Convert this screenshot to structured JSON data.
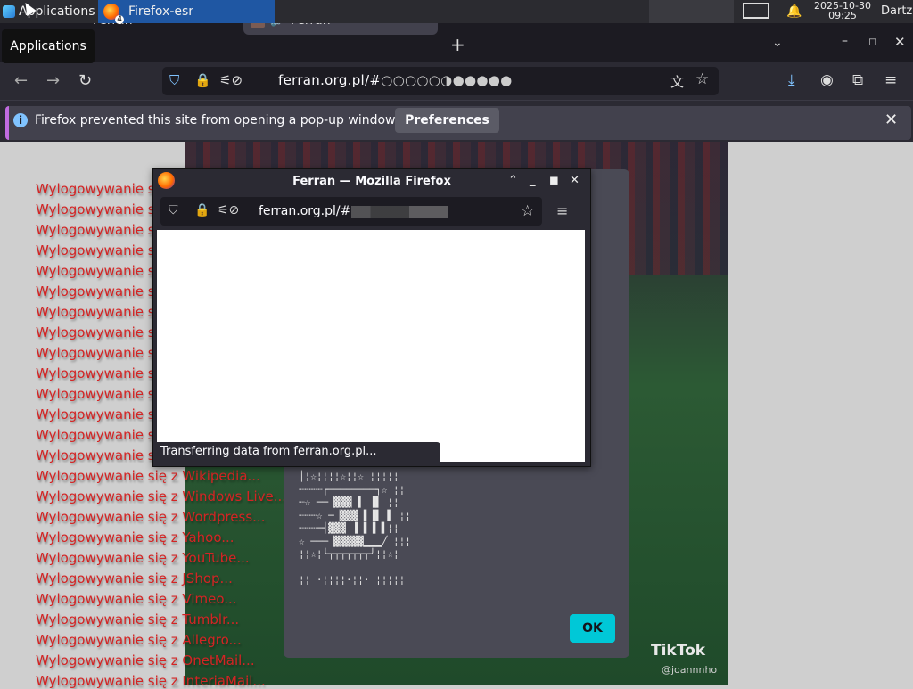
{
  "panel": {
    "applications_label": "Applications",
    "task_label": "Firefox-esr",
    "task_count": "4",
    "date": "2025-10-30",
    "time": "09:25",
    "user": "Dartz"
  },
  "tooltip": "Applications",
  "tabs": [
    {
      "label": "Ferran"
    },
    {
      "label": "Ferran"
    }
  ],
  "urlbar": {
    "url_host": "ferran.org.pl/#",
    "url_suffix": "○○○○○◑●●●●●"
  },
  "notification": {
    "text": "Firefox prevented this site from opening a pop-up window.",
    "button": "Preferences"
  },
  "popup": {
    "title": "Ferran — Mozilla Firefox",
    "url": "ferran.org.pl/#",
    "status": "Transferring data from ferran.org.pl..."
  },
  "dialog": {
    "ok": "OK"
  },
  "page_lines": [
    "Wylogowywanie si",
    "Wylogowywanie si",
    "Wylogowywanie si",
    "Wylogowywanie si",
    "Wylogowywanie si",
    "Wylogowywanie si",
    "Wylogowywanie si",
    "Wylogowywanie si",
    "Wylogowywanie si",
    "Wylogowywanie si",
    "Wylogowywanie si",
    "Wylogowywanie si",
    "Wylogowywanie si",
    "Wylogowywanie si",
    "Wylogowywanie się z Wikipedia...",
    "Wylogowywanie się z Windows Live...",
    "Wylogowywanie się z Wordpress...",
    "Wylogowywanie się z Yahoo...",
    "Wylogowywanie się z YouTube...",
    "Wylogowywanie się z JShop...",
    "Wylogowywanie się z Vimeo...",
    "Wylogowywanie się z Tumblr...",
    "Wylogowywanie się z Allegro...",
    "Wylogowywanie się z OnetMail...",
    "Wylogowywanie się z InteriaMail..."
  ],
  "tiktok": {
    "brand": "TikTok",
    "user": "@joannnho"
  },
  "colors": {
    "accent": "#00c8d7",
    "page_text": "#d42424",
    "notification_border": "#c06be0"
  }
}
